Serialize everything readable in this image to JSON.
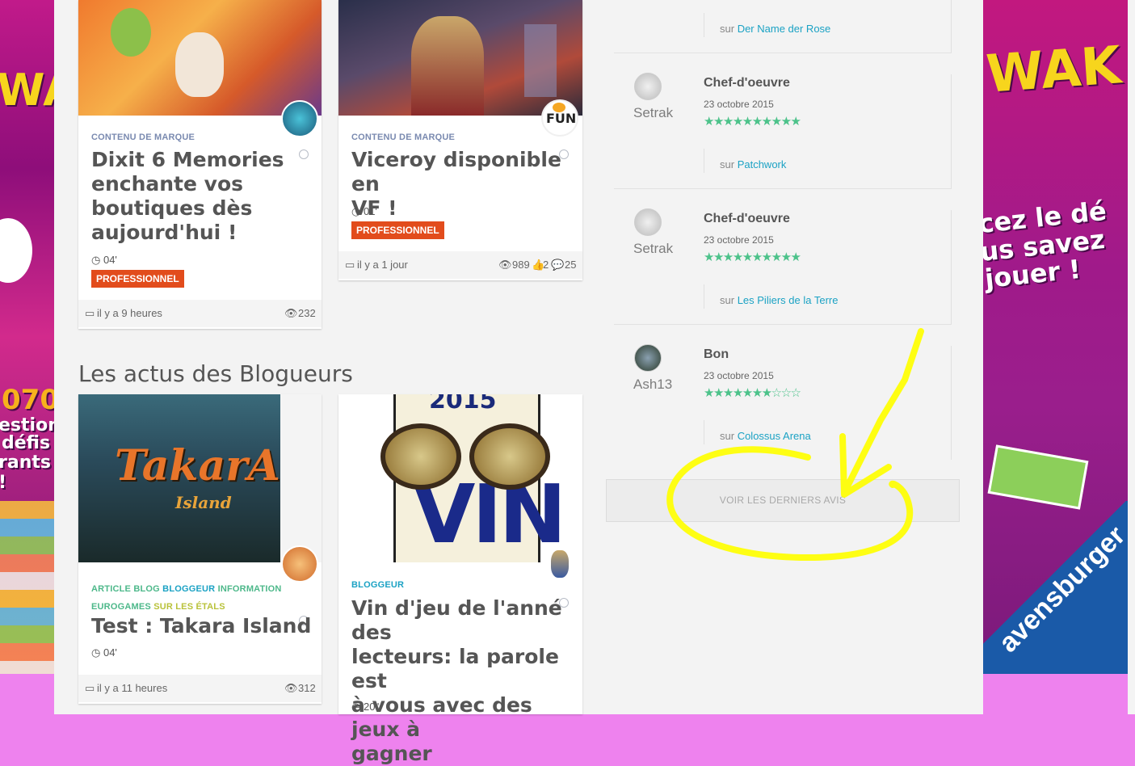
{
  "ads": {
    "left_text": [
      "WA",
      "070",
      "estions",
      "défis",
      "rants !"
    ],
    "right_text": [
      "WAK",
      "cez le dé",
      "us savez",
      "jouer !",
      "avensburger"
    ]
  },
  "top_cards": [
    {
      "category": "CONTENU DE MARQUE",
      "title_lines": [
        "Dixit 6 Memories",
        "enchante vos",
        "boutiques dès",
        "aujourd'hui !"
      ],
      "duration": "04'",
      "badge": "PROFESSIONNEL",
      "time": "il y a 9 heures",
      "views": "232"
    },
    {
      "category": "CONTENU DE MARQUE",
      "title_lines": [
        "Viceroy disponible en",
        "VF !"
      ],
      "duration": "01'",
      "badge": "PROFESSIONNEL",
      "time": "il y a 1 jour",
      "views": "989",
      "likes": "2",
      "comments": "25",
      "avatar_label": "FUN"
    }
  ],
  "section_title": "Les actus des Blogueurs",
  "blog_cards": [
    {
      "cats": [
        {
          "label": "ARTICLE BLOG",
          "color": "#4db88a"
        },
        {
          "label": "BLOGGEUR",
          "color": "#1ba2c4"
        },
        {
          "label": "INFORMATION",
          "color": "#4db88a"
        },
        {
          "label": "EUROGAMES",
          "color": "#4db88a"
        },
        {
          "label": "SUR LES ÉTALS",
          "color": "#b9c23a"
        }
      ],
      "title": "Test : Takara Island",
      "duration": "04'",
      "time": "il y a 11 heures",
      "views": "312",
      "img_text": "TakarA",
      "img_sub": "Island"
    },
    {
      "cats": [
        {
          "label": "BLOGGEUR",
          "color": "#1ba2c4"
        }
      ],
      "title_lines": [
        "Vin d'jeu de l'anné des",
        "lecteurs: la parole est",
        "à vous avec des jeux à",
        "gagner"
      ],
      "duration": "20''",
      "img_text": "VIN",
      "img_top": "2015"
    }
  ],
  "reviews": {
    "first_game": "Der Name der Rose",
    "items": [
      {
        "user": "Setrak",
        "title": "Chef-d'oeuvre",
        "date": "23 octobre 2015",
        "rating": 10,
        "game": "Patchwork"
      },
      {
        "user": "Setrak",
        "title": "Chef-d'oeuvre",
        "date": "23 octobre 2015",
        "rating": 10,
        "game": "Les Piliers de la Terre"
      },
      {
        "user": "Ash13",
        "title": "Bon",
        "date": "23 octobre 2015",
        "rating": 7,
        "game": "Colossus Arena"
      }
    ],
    "sur_label": "sur",
    "more_button": "VOIR LES DERNIERS AVIS"
  },
  "colors": {
    "accent_link": "#1ba2c4",
    "star": "#4cc28a",
    "badge": "#e24c1c",
    "highlight": "#ffff00"
  }
}
